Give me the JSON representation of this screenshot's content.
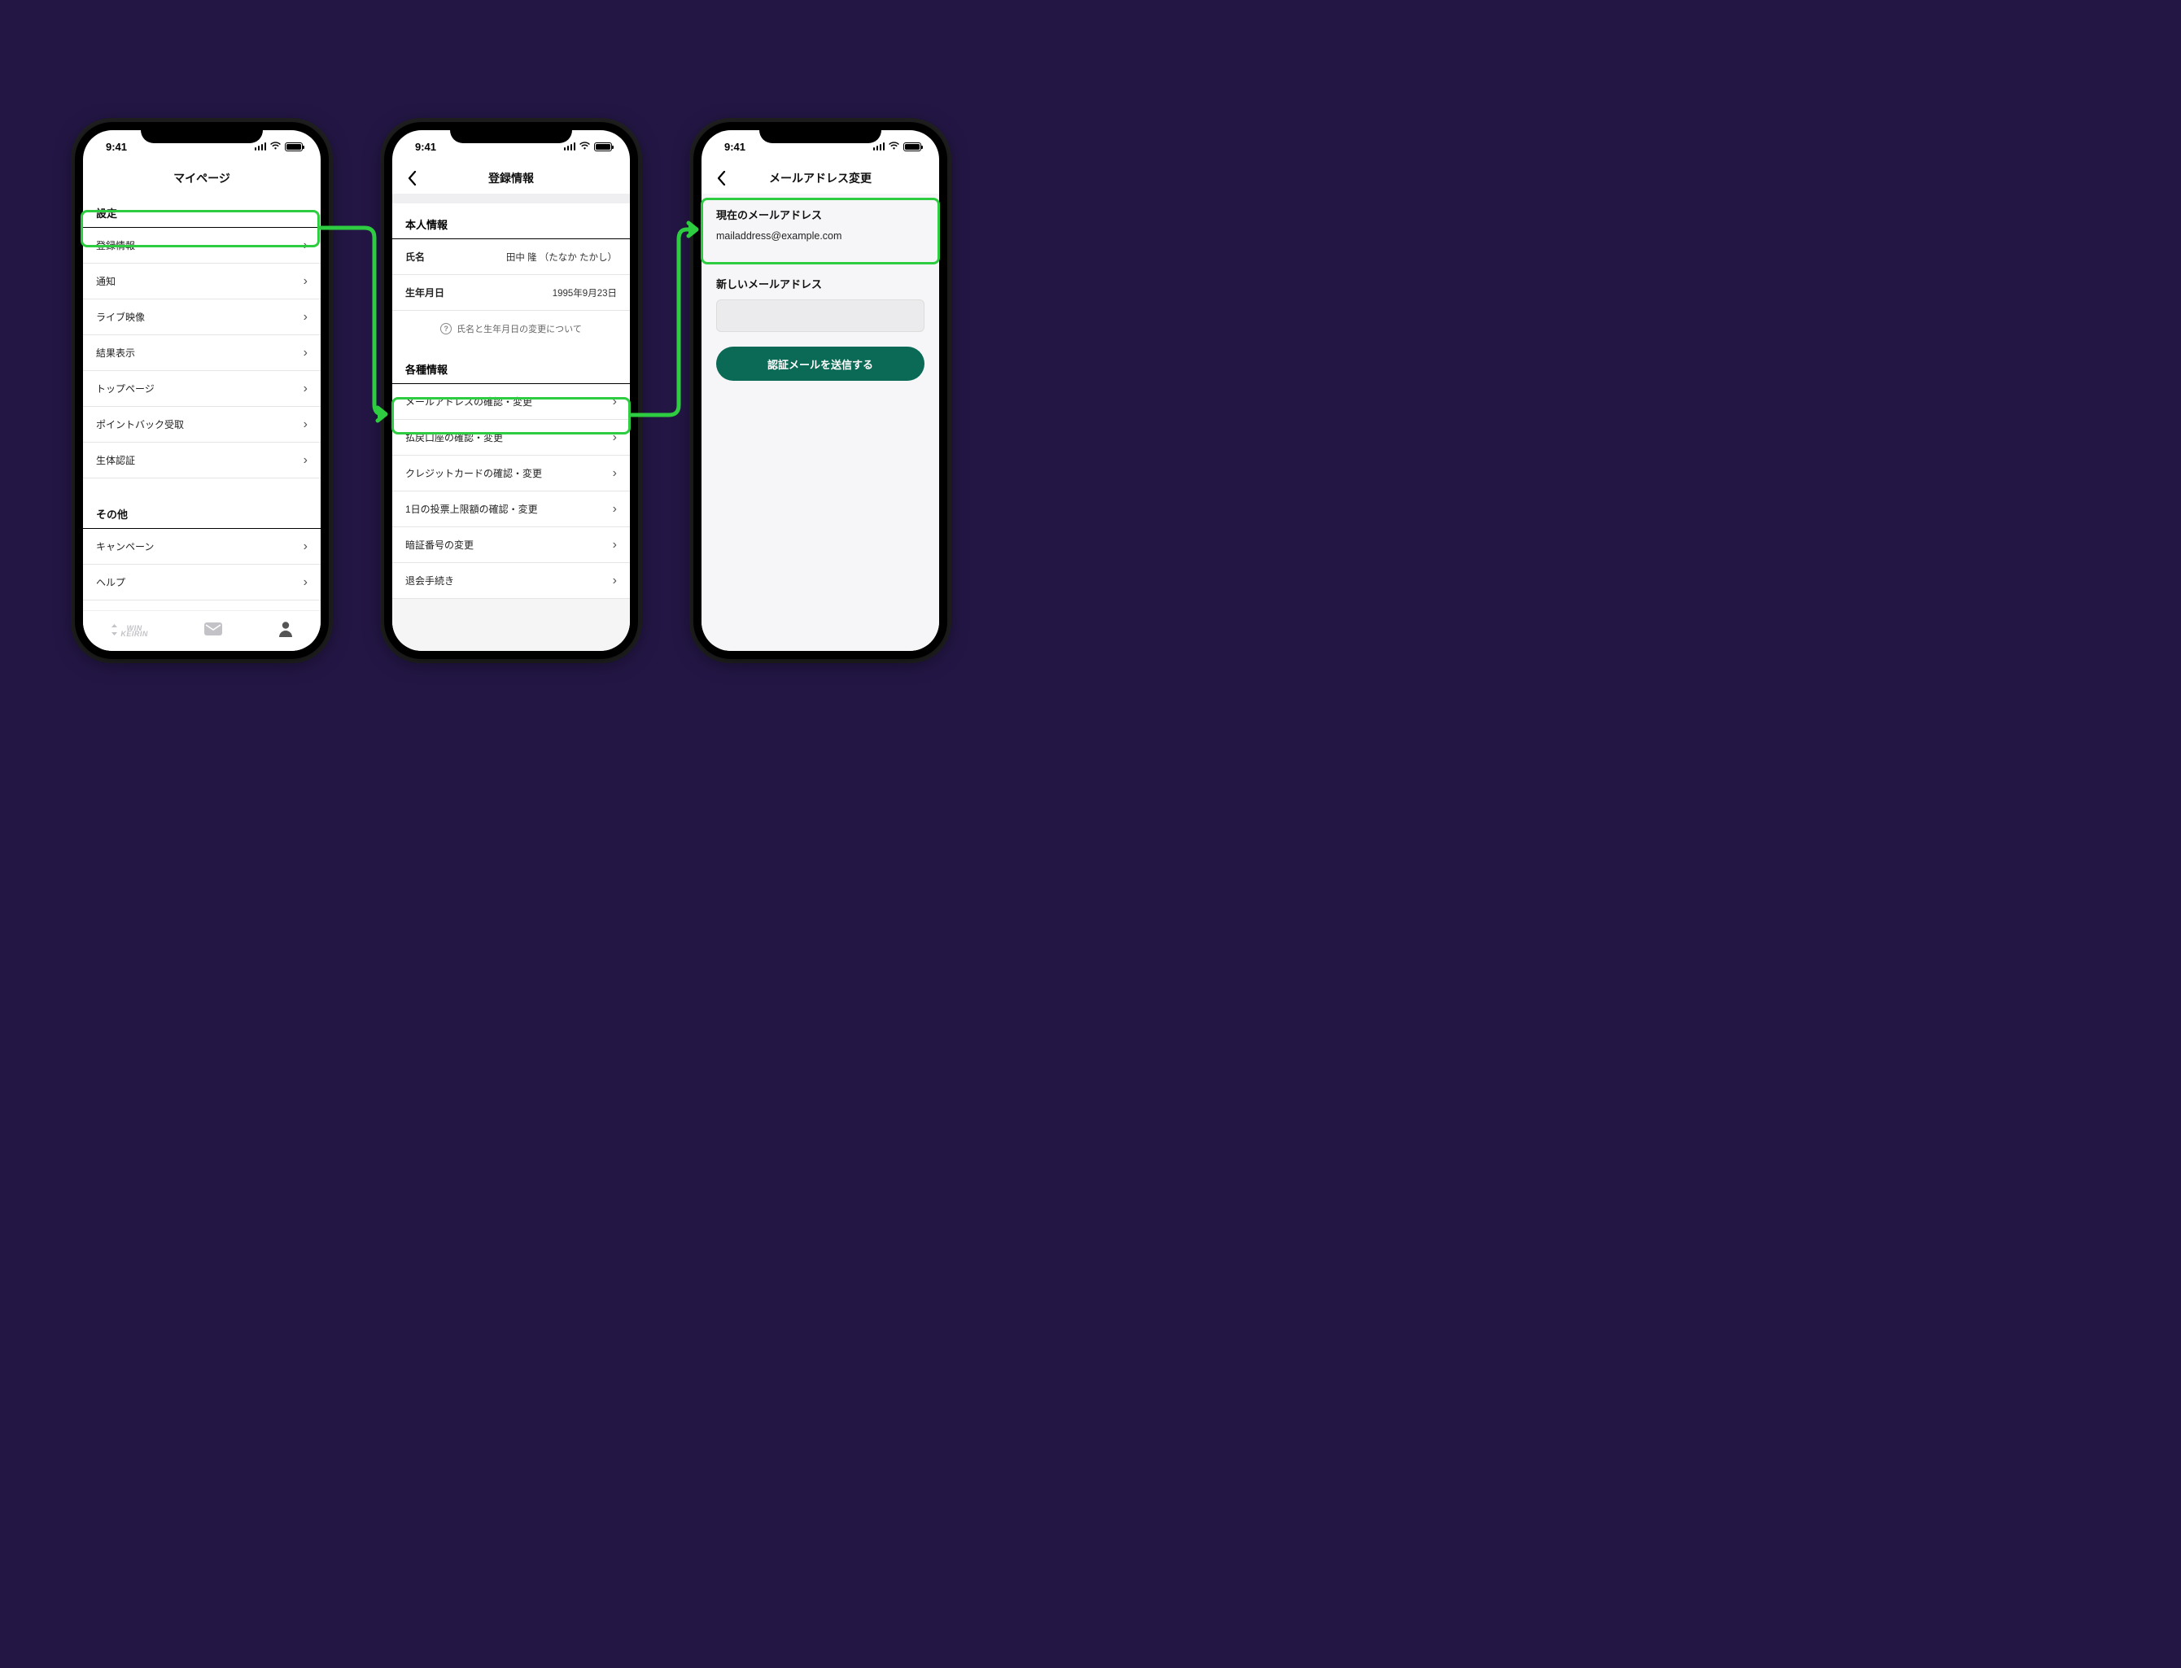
{
  "status": {
    "time": "9:41"
  },
  "phone1": {
    "title": "マイページ",
    "sections": {
      "settings_title": "設定",
      "settings_items": [
        "登録情報",
        "通知",
        "ライブ映像",
        "結果表示",
        "トップページ",
        "ポイントバック受取",
        "生体認証"
      ],
      "other_title": "その他",
      "other_items": [
        "キャンペーン",
        "ヘルプ"
      ]
    },
    "brand": {
      "top": "WIN",
      "bottom": "KEIRIN"
    }
  },
  "phone2": {
    "title": "登録情報",
    "personal": {
      "heading": "本人情報",
      "name_label": "氏名",
      "name_value": "田中 隆  （たなか たかし）",
      "dob_label": "生年月日",
      "dob_value": "1995年9月23日",
      "help": "氏名と生年月日の変更について"
    },
    "misc": {
      "heading": "各種情報",
      "items": [
        "メールアドレスの確認・変更",
        "払戻口座の確認・変更",
        "クレジットカードの確認・変更",
        "1日の投票上限額の確認・変更",
        "暗証番号の変更",
        "退会手続き"
      ]
    }
  },
  "phone3": {
    "title": "メールアドレス変更",
    "current_label": "現在のメールアドレス",
    "current_value": "mailaddress@example.com",
    "new_label": "新しいメールアドレス",
    "button": "認証メールを送信する"
  }
}
